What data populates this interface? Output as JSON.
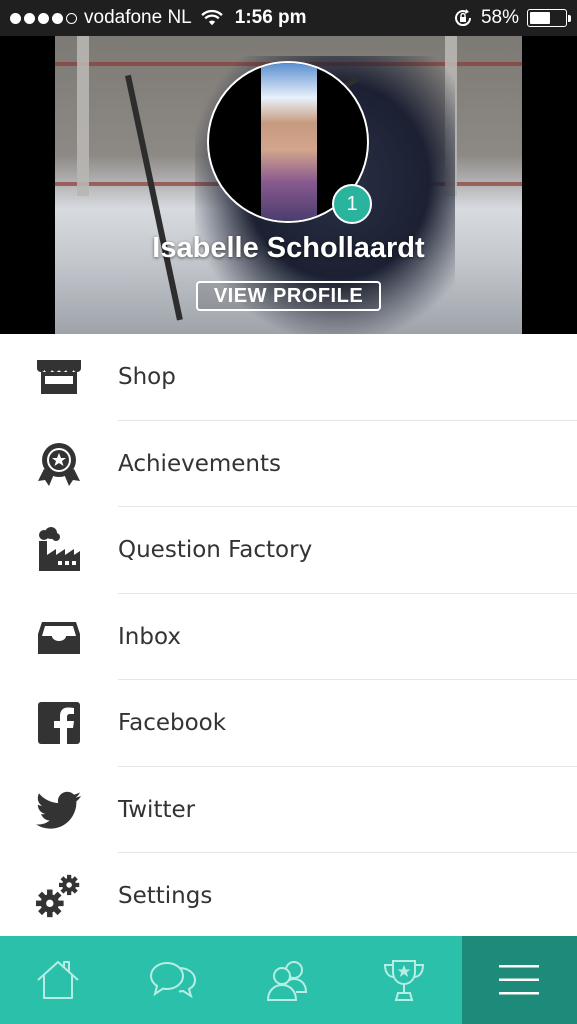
{
  "status_bar": {
    "carrier": "vodafone NL",
    "time": "1:56 pm",
    "battery_percent": "58%",
    "battery_level": 0.58,
    "signal_bars_filled": 4,
    "signal_bars_total": 5
  },
  "profile": {
    "name": "Isabelle Schollaardt",
    "view_profile_label": "VIEW PROFILE",
    "notification_count": "1"
  },
  "menu": {
    "items": [
      {
        "label": "Shop",
        "icon": "shop-icon"
      },
      {
        "label": "Achievements",
        "icon": "achievement-badge-icon"
      },
      {
        "label": "Question Factory",
        "icon": "factory-icon"
      },
      {
        "label": "Inbox",
        "icon": "inbox-icon"
      },
      {
        "label": "Facebook",
        "icon": "facebook-icon"
      },
      {
        "label": "Twitter",
        "icon": "twitter-icon"
      },
      {
        "label": "Settings",
        "icon": "gears-icon"
      }
    ]
  },
  "tab_bar": {
    "tabs": [
      {
        "icon": "home-icon"
      },
      {
        "icon": "chat-bubbles-icon"
      },
      {
        "icon": "friends-icon"
      },
      {
        "icon": "trophy-icon"
      },
      {
        "icon": "hamburger-menu-icon",
        "active": true
      }
    ]
  },
  "colors": {
    "accent": "#2bc0a9",
    "accent_dark": "#1e8b7a",
    "badge": "#2ab39d",
    "icon_dark": "#333333"
  }
}
